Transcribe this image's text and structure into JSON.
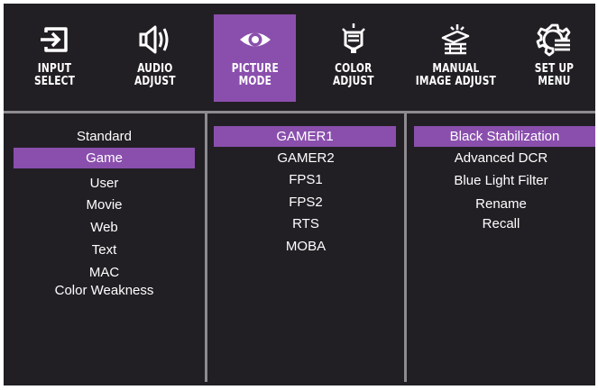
{
  "tabs": [
    {
      "line1": "INPUT",
      "line2": "SELECT",
      "icon": "input-select-icon"
    },
    {
      "line1": "AUDIO",
      "line2": "ADJUST",
      "icon": "audio-icon"
    },
    {
      "line1": "PICTURE",
      "line2": "MODE",
      "icon": "eye-icon",
      "active": true
    },
    {
      "line1": "COLOR",
      "line2": "ADJUST",
      "icon": "color-bulb-icon"
    },
    {
      "line1": "MANUAL",
      "line2": "IMAGE ADJUST",
      "icon": "manual-image-icon"
    },
    {
      "line1": "SET UP",
      "line2": "MENU",
      "icon": "gear-setup-icon"
    }
  ],
  "picture_modes": [
    "Standard",
    "Game",
    "User",
    "Movie",
    "Web",
    "Text",
    "MAC",
    "Color Weakness"
  ],
  "picture_mode_selected": "Game",
  "game_modes": [
    "GAMER1",
    "GAMER2",
    "FPS1",
    "FPS2",
    "RTS",
    "MOBA"
  ],
  "game_mode_selected": "GAMER1",
  "settings": [
    "Black Stabilization",
    "Advanced DCR",
    "Blue Light Filter",
    "Rename",
    "Recall"
  ],
  "setting_selected": "Black Stabilization",
  "colors": {
    "background": "#221f24",
    "accent": "#8a4fad",
    "separator": "#8d8b8f",
    "text": "#ffffff"
  }
}
